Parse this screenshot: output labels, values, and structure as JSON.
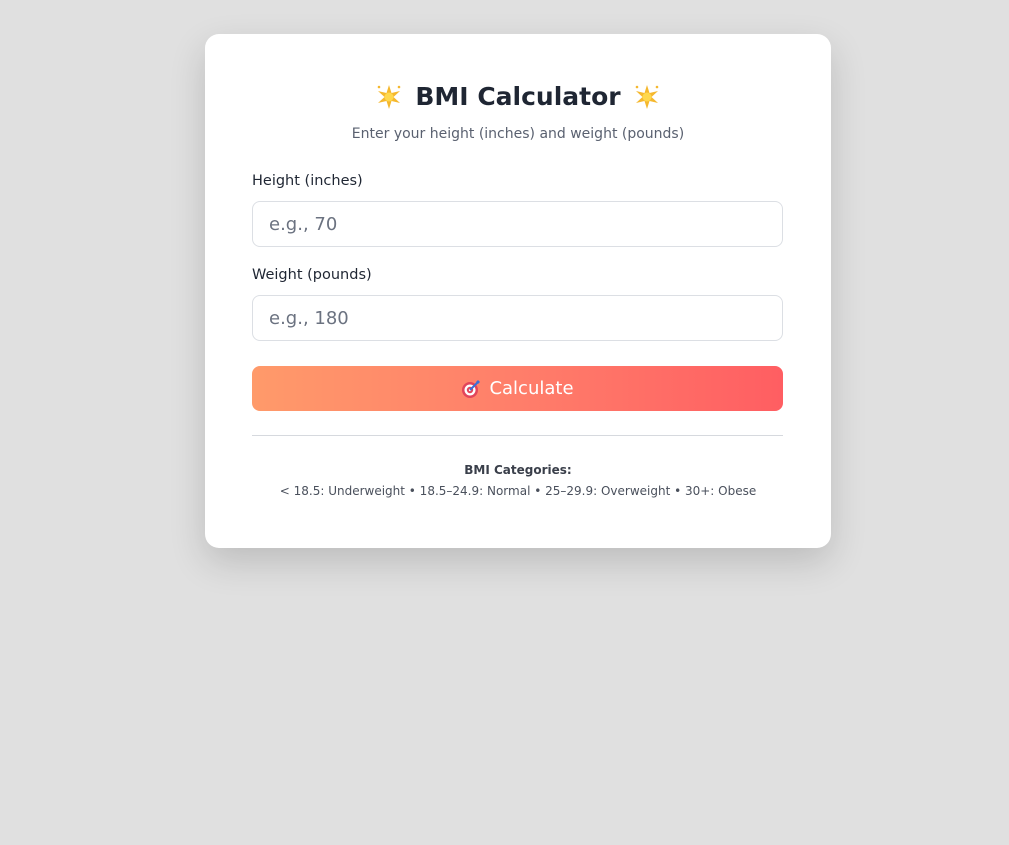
{
  "header": {
    "title": "BMI Calculator",
    "left_icon": "sparkle-star-icon",
    "right_icon": "sparkle-star-icon",
    "subtitle": "Enter your height (inches) and weight (pounds)"
  },
  "form": {
    "height": {
      "label": "Height (inches)",
      "value": "",
      "placeholder": "e.g., 70"
    },
    "weight": {
      "label": "Weight (pounds)",
      "value": "",
      "placeholder": "e.g., 180"
    },
    "calculate_button": {
      "label": "Calculate",
      "icon": "target-icon"
    }
  },
  "categories": {
    "title": "BMI Categories:",
    "text": "< 18.5: Underweight • 18.5–24.9: Normal • 25–29.9: Overweight • 30+: Obese"
  },
  "colors": {
    "background": "#e0e0e0",
    "card": "#ffffff",
    "button_gradient_start": "#ff9a6a",
    "button_gradient_end": "#ff5e62",
    "title_text": "#1f2633"
  }
}
